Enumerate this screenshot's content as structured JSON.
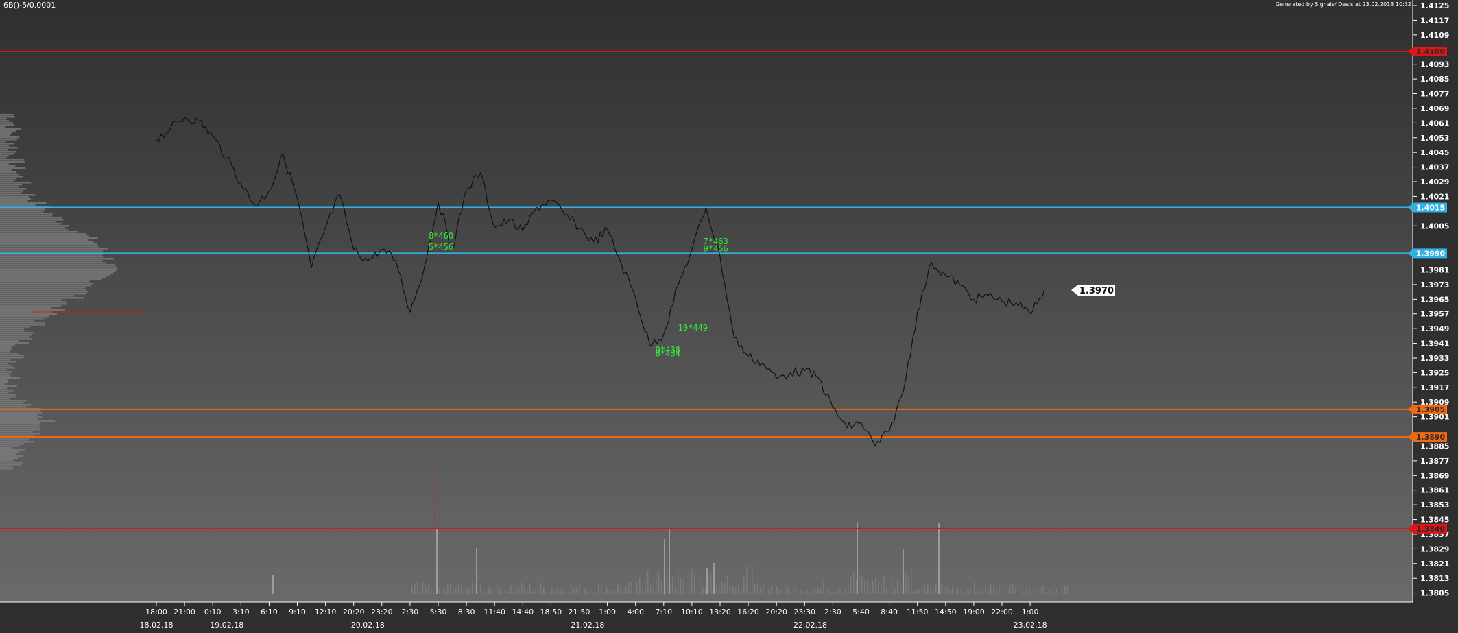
{
  "header": {
    "symbol_label": "6B()-5/0.0001",
    "generated_label": "Generated by Signals4Deals at 23.02.2018 10:32"
  },
  "colors": {
    "background_top": "#2f2f2f",
    "background_bottom": "#6a6a6a",
    "price_line": "#111111",
    "axis_text": "#ffffff",
    "red_level": "#e01414",
    "blue_level": "#2fb0e6",
    "orange_level": "#f26a10",
    "annotation_green": "#35e83a",
    "volume_profile": "#7f7f7f",
    "volume_bars": "#8a8a8a"
  },
  "chart_data": {
    "type": "line",
    "title": "6B()-5/0.0001",
    "xlabel": "",
    "ylabel": "",
    "ylim": [
      1.38,
      1.4128
    ],
    "grid": false,
    "y_ticks": [
      "1.4125",
      "1.4117",
      "1.4109",
      "1.4093",
      "1.4085",
      "1.4077",
      "1.4069",
      "1.4061",
      "1.4053",
      "1.4045",
      "1.4037",
      "1.4029",
      "1.4021",
      "1.4005",
      "1.3981",
      "1.3973",
      "1.3965",
      "1.3957",
      "1.3949",
      "1.3941",
      "1.3933",
      "1.3925",
      "1.3917",
      "1.3909",
      "1.3901",
      "1.3885",
      "1.3877",
      "1.3869",
      "1.3861",
      "1.3853",
      "1.3845",
      "1.3837",
      "1.3829",
      "1.3821",
      "1.3813",
      "1.3805"
    ],
    "x_ticks": [
      "18:00",
      "21:00",
      "0:10",
      "3:10",
      "6:10",
      "9:10",
      "12:10",
      "20:20",
      "23:20",
      "2:30",
      "5:30",
      "8:30",
      "11:40",
      "14:40",
      "18:50",
      "21:50",
      "1:00",
      "4:00",
      "7:10",
      "10:10",
      "13:20",
      "16:20",
      "20:20",
      "23:30",
      "2:30",
      "5:40",
      "8:40",
      "11:50",
      "14:50",
      "19:00",
      "22:00",
      "1:00"
    ],
    "date_labels": [
      "18.02.18",
      "19.02.18",
      "20.02.18",
      "21.02.18",
      "22.02.18",
      "23.02.18"
    ],
    "levels": [
      {
        "value": 1.41,
        "label": "1.4100",
        "color": "red"
      },
      {
        "value": 1.4015,
        "label": "1.4015",
        "color": "blue"
      },
      {
        "value": 1.399,
        "label": "1.3990",
        "color": "blue"
      },
      {
        "value": 1.3905,
        "label": "1.3905",
        "color": "orange"
      },
      {
        "value": 1.389,
        "label": "1.3890",
        "color": "orange"
      },
      {
        "value": 1.384,
        "label": "1.3840",
        "color": "red"
      }
    ],
    "last_price": {
      "value": 1.397,
      "label": "1.3970"
    },
    "series": [
      {
        "x": [
          0,
          0.5,
          1,
          1.5,
          2,
          2.5,
          3,
          3.5,
          4,
          4.5,
          5,
          5.5,
          6,
          6.5,
          7,
          7.5,
          8,
          8.5,
          9,
          9.5,
          10,
          10.5,
          11,
          11.5,
          12,
          12.5,
          13,
          13.5,
          14,
          14.5,
          15,
          15.5,
          16,
          16.5,
          17,
          17.5,
          18,
          18.5,
          19,
          19.5,
          20,
          20.5,
          21,
          21.5,
          22,
          22.5,
          23,
          23.5,
          24,
          24.5,
          25,
          25.5,
          26,
          26.5,
          27,
          27.5,
          28,
          28.5,
          29,
          29.5,
          30,
          30.5,
          31,
          31.5
        ],
        "values": [
          1.4052,
          1.4058,
          1.4064,
          1.4062,
          1.4054,
          1.4042,
          1.4028,
          1.4016,
          1.4024,
          1.4044,
          1.402,
          1.3982,
          1.4004,
          1.4022,
          1.3992,
          1.3986,
          1.3992,
          1.3986,
          1.3958,
          1.3982,
          1.4018,
          1.3992,
          1.4025,
          1.4034,
          1.4004,
          1.4008,
          1.4002,
          1.4015,
          1.4019,
          1.4011,
          1.4004,
          1.3996,
          1.4003,
          1.3984,
          1.3966,
          1.394,
          1.3946,
          1.3972,
          1.3992,
          1.4015,
          1.3988,
          1.3944,
          1.3934,
          1.393,
          1.3922,
          1.3925,
          1.3926,
          1.3922,
          1.3906,
          1.3895,
          1.3898,
          1.3885,
          1.3893,
          1.3915,
          1.3958,
          1.3985,
          1.3978,
          1.3973,
          1.3965,
          1.3967,
          1.3964,
          1.3963,
          1.3957,
          1.397
        ]
      }
    ],
    "annotations": [
      {
        "text": "8*460",
        "x": 9.95,
        "y": 1.3998
      },
      {
        "text": "5*456",
        "x": 9.95,
        "y": 1.3992
      },
      {
        "text": "7*463",
        "x": 19.7,
        "y": 1.3995
      },
      {
        "text": "9*456",
        "x": 19.7,
        "y": 1.3991
      },
      {
        "text": "10*449",
        "x": 18.8,
        "y": 1.3948
      },
      {
        "text": "9*438",
        "x": 18.0,
        "y": 1.3936
      },
      {
        "text": "8*434",
        "x": 18.0,
        "y": 1.3934
      }
    ]
  }
}
